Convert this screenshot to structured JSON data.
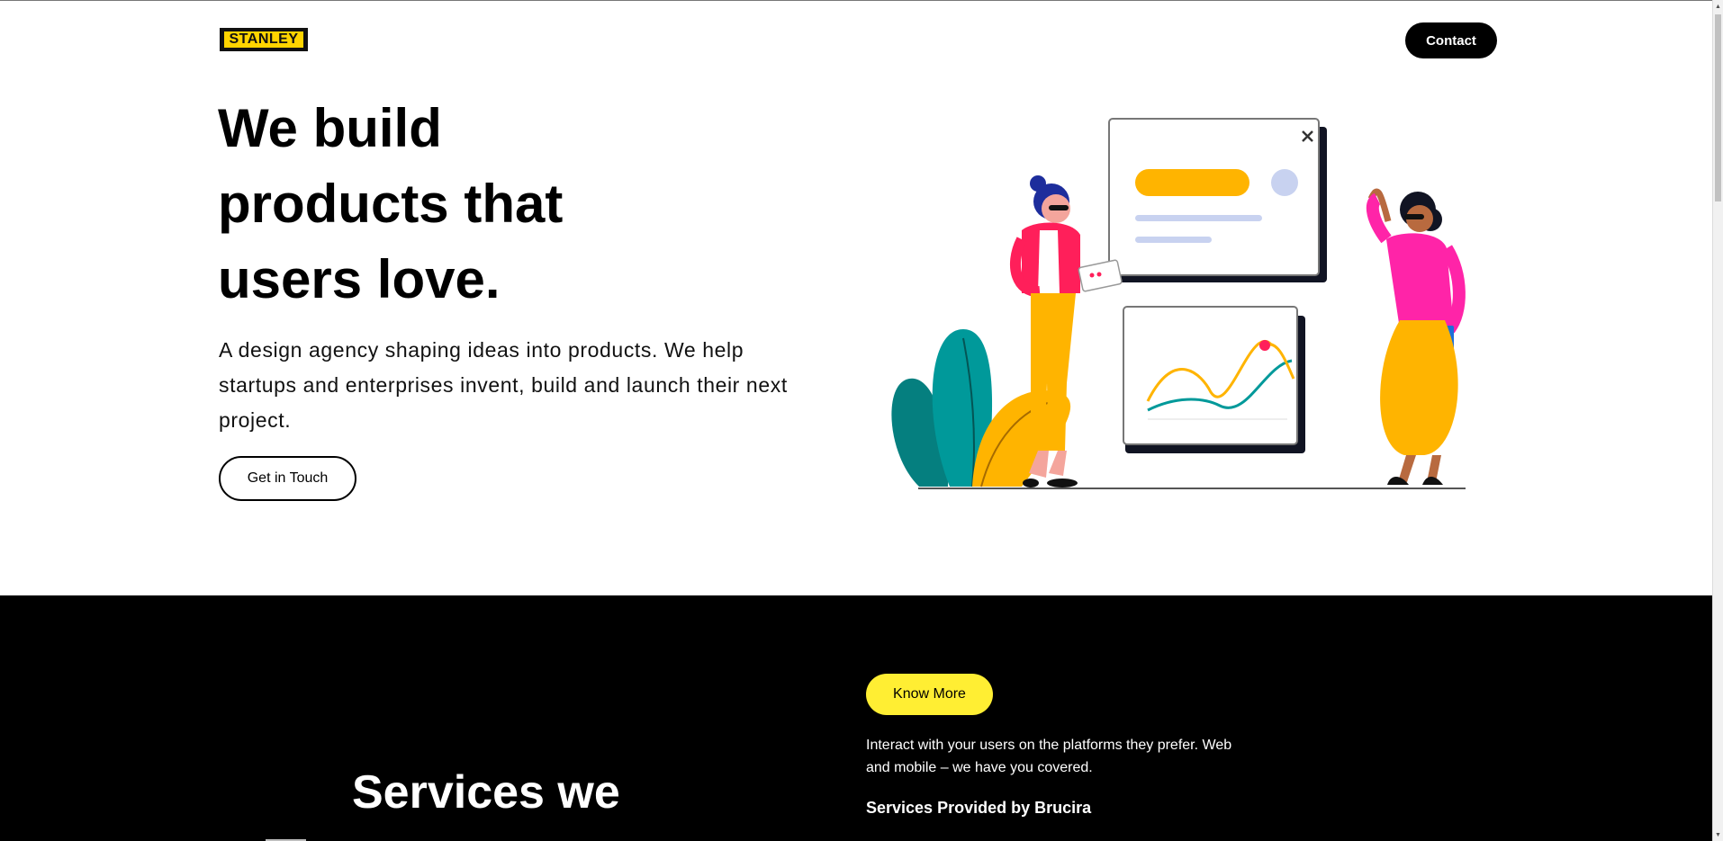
{
  "header": {
    "logo_text": "STANLEY",
    "contact_label": "Contact"
  },
  "hero": {
    "title_lines": [
      "We build",
      "products that",
      "users love."
    ],
    "description": "A design agency shaping ideas into products. We help startups and enterprises invent, build and launch their next project.",
    "cta_label": "Get in Touch"
  },
  "services": {
    "title": "Services we",
    "know_more_label": "Know More",
    "description": "Interact with your users on the platforms they prefer. Web and mobile – we have you covered.",
    "provided_heading": "Services Provided by Brucira"
  },
  "colors": {
    "brand_yellow": "#ffd400",
    "know_more_yellow": "#ffee33",
    "dark_section": "#000000",
    "accent_orange": "#ffb400",
    "accent_pink": "#ff1f8f",
    "accent_teal": "#00999a"
  },
  "icons": {
    "close": "close-icon",
    "scroll_up": "chevron-up-icon",
    "scroll_down": "chevron-down-icon"
  }
}
